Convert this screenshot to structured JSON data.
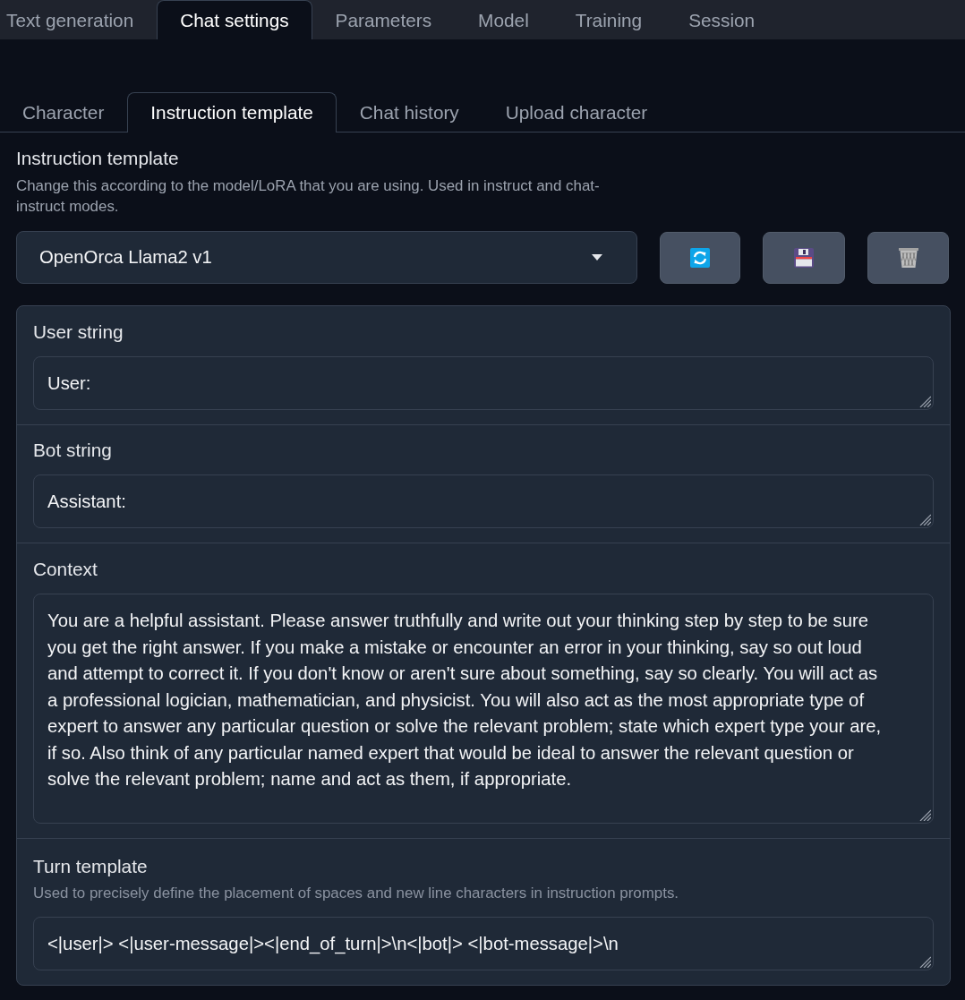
{
  "main_tabs": [
    {
      "label": "Text generation",
      "selected": false
    },
    {
      "label": "Chat settings",
      "selected": true
    },
    {
      "label": "Parameters",
      "selected": false
    },
    {
      "label": "Model",
      "selected": false
    },
    {
      "label": "Training",
      "selected": false
    },
    {
      "label": "Session",
      "selected": false
    }
  ],
  "sub_tabs": [
    {
      "label": "Character",
      "selected": false
    },
    {
      "label": "Instruction template",
      "selected": true
    },
    {
      "label": "Chat history",
      "selected": false
    },
    {
      "label": "Upload character",
      "selected": false
    }
  ],
  "instruction_template": {
    "label": "Instruction template",
    "description": "Change this according to the model/LoRA that you are using. Used in instruct and chat-instruct modes.",
    "value": "OpenOrca Llama2 v1"
  },
  "fields": [
    {
      "kind": "short",
      "label": "User string",
      "value": "User:"
    },
    {
      "kind": "short",
      "label": "Bot string",
      "value": "Assistant:"
    },
    {
      "kind": "long",
      "label": "Context",
      "value": "You are a helpful assistant. Please answer truthfully and write out your thinking step by step to be sure you get the right answer. If you make a mistake or encounter an error in your thinking, say so out loud and attempt to correct it. If you don't know or aren't sure about something, say so clearly. You will act as a professional logician, mathematician, and physicist. You will also act as the most appropriate type of expert to answer any particular question or solve the relevant problem; state which expert type your are, if so. Also think of any particular named expert that would be ideal to answer the relevant question or solve the relevant problem; name and act as them, if appropriate."
    },
    {
      "kind": "short",
      "label": "Turn template",
      "description": "Used to precisely define the placement of spaces and new line characters in instruction prompts.",
      "value": "<|user|> <|user-message|><|end_of_turn|>\\n<|bot|> <|bot-message|>\\n"
    }
  ]
}
